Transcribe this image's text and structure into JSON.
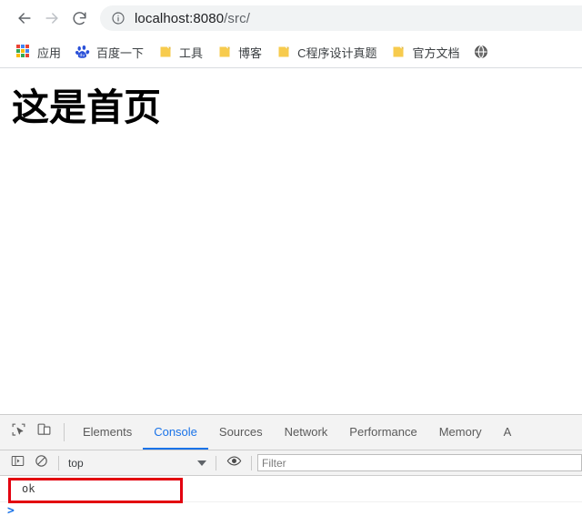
{
  "browser": {
    "nav": {
      "back_icon": "arrow-left-icon",
      "forward_icon": "arrow-right-icon",
      "reload_icon": "reload-icon",
      "back_enabled": true,
      "forward_enabled": false
    },
    "omnibox": {
      "security_icon": "info-circle-icon",
      "host": "localhost:8080",
      "path": "/src/",
      "full_url": "localhost:8080/src/"
    },
    "bookmarks": [
      {
        "label": "应用",
        "icon": "apps-grid-icon"
      },
      {
        "label": "百度一下",
        "icon": "baidu-paw-icon"
      },
      {
        "label": "工具",
        "icon": "folder-icon"
      },
      {
        "label": "博客",
        "icon": "folder-icon"
      },
      {
        "label": "C程序设计真题",
        "icon": "folder-icon"
      },
      {
        "label": "官方文档",
        "icon": "folder-icon"
      },
      {
        "label": "",
        "icon": "globe-icon"
      }
    ]
  },
  "page": {
    "heading": "这是首页"
  },
  "devtools": {
    "toolbar_icons": [
      {
        "name": "inspect-element-icon"
      },
      {
        "name": "device-toolbar-icon"
      }
    ],
    "tabs": [
      {
        "label": "Elements",
        "active": false
      },
      {
        "label": "Console",
        "active": true
      },
      {
        "label": "Sources",
        "active": false
      },
      {
        "label": "Network",
        "active": false
      },
      {
        "label": "Performance",
        "active": false
      },
      {
        "label": "Memory",
        "active": false
      },
      {
        "label": "A",
        "active": false
      }
    ],
    "console_toolbar": {
      "sidebar_icon": "console-sidebar-icon",
      "clear_icon": "clear-console-icon",
      "context": "top",
      "eye_icon": "live-expression-eye-icon",
      "filter_placeholder": "Filter",
      "filter_value": ""
    },
    "console_output": [
      {
        "message": "ok"
      }
    ],
    "prompt_symbol": ">",
    "annotation_color": "#e3000f"
  },
  "colors": {
    "accent": "#1a73e8",
    "omnibox_bg": "#f1f3f4",
    "devtools_bg": "#f3f3f3",
    "annotation_red": "#e3000f",
    "folder_yellow": "#f7cb4d"
  }
}
